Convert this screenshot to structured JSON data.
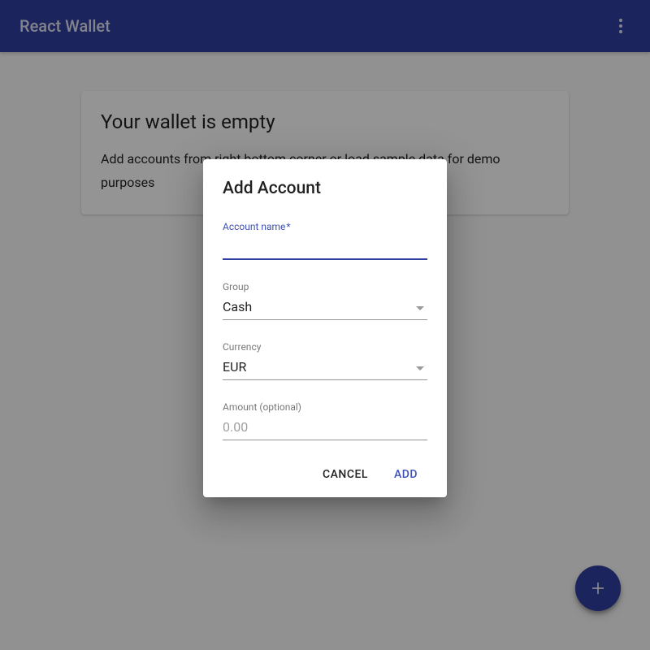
{
  "app": {
    "title": "React Wallet"
  },
  "card": {
    "title": "Your wallet is empty",
    "text": "Add accounts from right bottom corner or load sample data for demo purposes"
  },
  "dialog": {
    "title": "Add Account",
    "fields": {
      "name": {
        "label": "Account name",
        "required_mark": "*",
        "value": ""
      },
      "group": {
        "label": "Group",
        "value": "Cash"
      },
      "currency": {
        "label": "Currency",
        "value": "EUR"
      },
      "amount": {
        "label": "Amount (optional)",
        "placeholder": "0.00",
        "value": ""
      }
    },
    "actions": {
      "cancel": "Cancel",
      "confirm": "Add"
    }
  },
  "colors": {
    "primary": "#303f9f",
    "accent": "#3f51b5"
  }
}
